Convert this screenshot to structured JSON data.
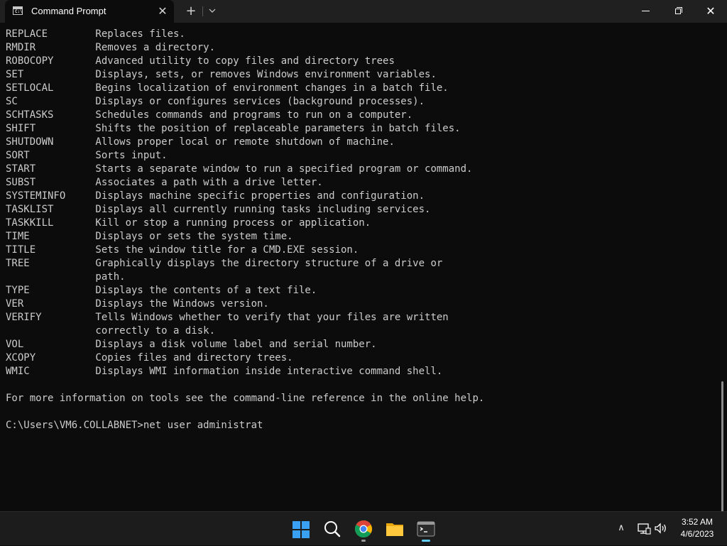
{
  "window": {
    "tab_title": "Command Prompt",
    "tab_icon": "cmd-icon",
    "tab_close": "✕",
    "new_tab": "+",
    "dropdown": "⌄",
    "close": "✕"
  },
  "terminal": {
    "lines": [
      "REPLACE        Replaces files.",
      "RMDIR          Removes a directory.",
      "ROBOCOPY       Advanced utility to copy files and directory trees",
      "SET            Displays, sets, or removes Windows environment variables.",
      "SETLOCAL       Begins localization of environment changes in a batch file.",
      "SC             Displays or configures services (background processes).",
      "SCHTASKS       Schedules commands and programs to run on a computer.",
      "SHIFT          Shifts the position of replaceable parameters in batch files.",
      "SHUTDOWN       Allows proper local or remote shutdown of machine.",
      "SORT           Sorts input.",
      "START          Starts a separate window to run a specified program or command.",
      "SUBST          Associates a path with a drive letter.",
      "SYSTEMINFO     Displays machine specific properties and configuration.",
      "TASKLIST       Displays all currently running tasks including services.",
      "TASKKILL       Kill or stop a running process or application.",
      "TIME           Displays or sets the system time.",
      "TITLE          Sets the window title for a CMD.EXE session.",
      "TREE           Graphically displays the directory structure of a drive or",
      "               path.",
      "TYPE           Displays the contents of a text file.",
      "VER            Displays the Windows version.",
      "VERIFY         Tells Windows whether to verify that your files are written",
      "               correctly to a disk.",
      "VOL            Displays a disk volume label and serial number.",
      "XCOPY          Copies files and directory trees.",
      "WMIC           Displays WMI information inside interactive command shell.",
      "",
      "For more information on tools see the command-line reference in the online help.",
      "",
      "C:\\Users\\VM6.COLLABNET>net user administrat"
    ]
  },
  "taskbar": {
    "apps": [
      {
        "name": "start",
        "icon": "windows-logo-icon"
      },
      {
        "name": "search",
        "icon": "search-icon"
      },
      {
        "name": "chrome",
        "icon": "chrome-icon"
      },
      {
        "name": "file-explorer",
        "icon": "folder-icon"
      },
      {
        "name": "terminal",
        "icon": "terminal-icon"
      }
    ],
    "tray": {
      "chevron": "∧",
      "network_icon": "network-icon",
      "volume_icon": "volume-icon"
    },
    "time": "3:52 AM",
    "date": "4/6/2023"
  },
  "colors": {
    "terminal_bg": "#0c0c0c",
    "terminal_fg": "#cccccc",
    "titlebar_bg": "#202020",
    "taskbar_bg": "#1c1c1c",
    "accent": "#60cdff",
    "windows_blue": "#3aa0f3"
  }
}
